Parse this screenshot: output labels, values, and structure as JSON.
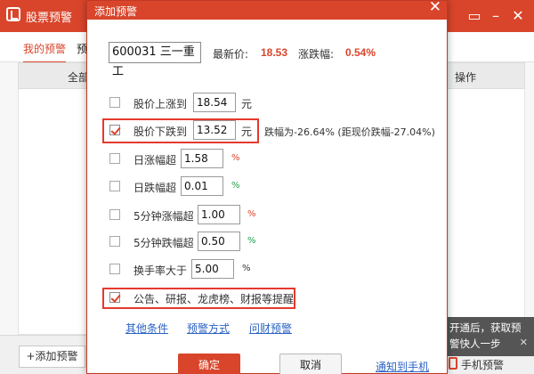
{
  "background_window": {
    "title": "股票预警",
    "tabs": [
      "我的预警",
      "预"
    ],
    "header": {
      "col_all": "全部",
      "col_action": "操作"
    },
    "add_button": "+添加预警",
    "tip_text": "开通后，获取预警快人一步",
    "mobile_label": "手机预警"
  },
  "dialog": {
    "title": "添加预警",
    "stock_field": "600031 三一重工",
    "latest_price_label": "最新价:",
    "latest_price": "18.53",
    "change_label": "涨跌幅:",
    "change_value": "0.54%",
    "rows": [
      {
        "label": "股价上涨到",
        "value": "18.54",
        "unit": "元",
        "checked": false
      },
      {
        "label": "股价下跌到",
        "value": "13.52",
        "unit": "元",
        "checked": true,
        "note": "跌幅为-26.64% (距现价跌幅-27.04%)"
      },
      {
        "label": "日涨幅超",
        "value": "1.58",
        "unit": "%",
        "checked": false
      },
      {
        "label": "日跌幅超",
        "value": "0.01",
        "unit": "%",
        "checked": false
      },
      {
        "label": "5分钟涨幅超",
        "value": "1.00",
        "unit": "%",
        "checked": false
      },
      {
        "label": "5分钟跌幅超",
        "value": "0.50",
        "unit": "%",
        "checked": false
      },
      {
        "label": "换手率大于",
        "value": "5.00",
        "unit": "%",
        "checked": false
      },
      {
        "label": "公告、研报、龙虎榜、财报等提醒",
        "checked": true
      }
    ],
    "links": {
      "other": "其他条件",
      "method": "预警方式",
      "history": "问财预警"
    },
    "ok_button": "确定",
    "cancel_button": "取消",
    "notify_link": "通知到手机"
  },
  "colors": {
    "accent": "#d9452b",
    "up": "#d9452b",
    "down": "#22a04a",
    "link": "#2b63c4",
    "highlight": "#e33a2e"
  }
}
